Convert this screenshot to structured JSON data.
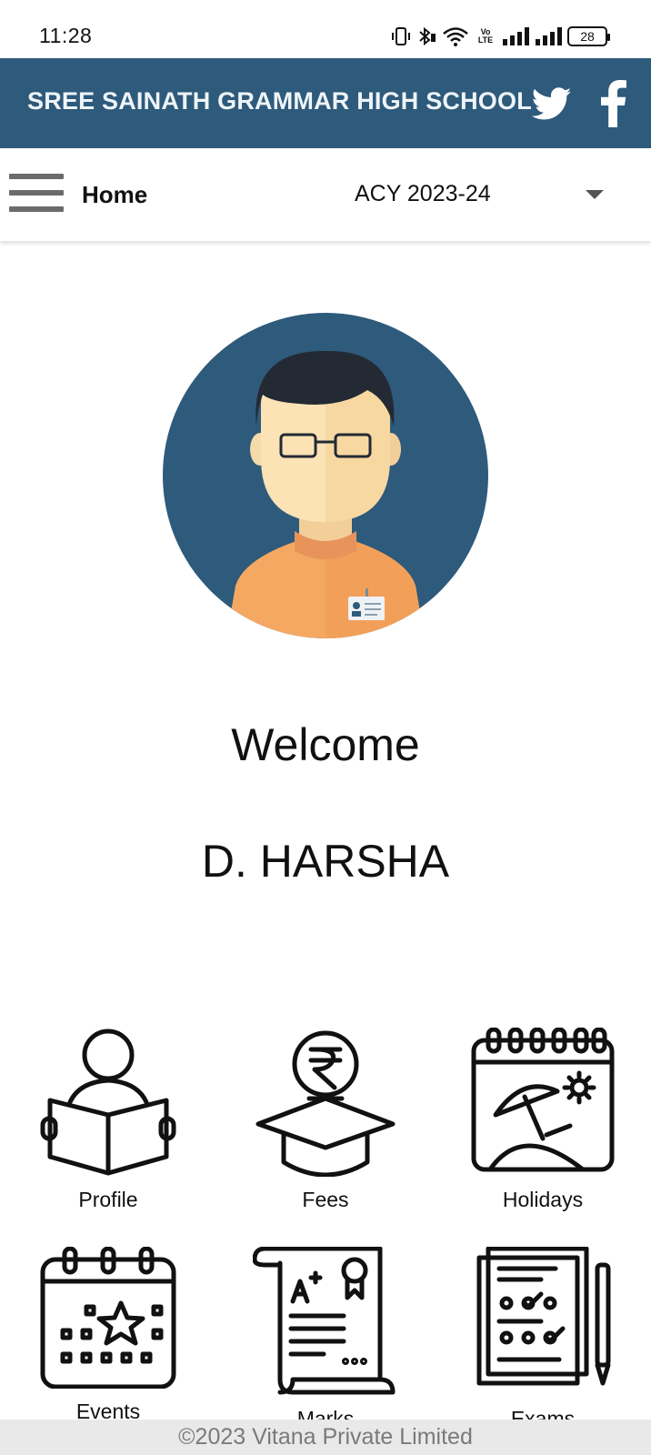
{
  "status_bar": {
    "time": "11:28",
    "volte_line1": "Vo",
    "volte_line2": "LTE",
    "battery": "28"
  },
  "header": {
    "school_name": "SREE SAINATH GRAMMAR HIGH SCHOOL",
    "background_color": "#2e5a7b",
    "twitter_icon": "twitter-icon",
    "facebook_icon": "facebook-icon"
  },
  "nav": {
    "title": "Home",
    "academic_year": "ACY 2023-24"
  },
  "main": {
    "welcome": "Welcome",
    "user_name": "D. HARSHA"
  },
  "menu": [
    {
      "label": "Profile",
      "icon": "reading-student-icon"
    },
    {
      "label": "Fees",
      "icon": "rupee-graduation-cap-icon"
    },
    {
      "label": "Holidays",
      "icon": "holiday-calendar-icon"
    },
    {
      "label": "Events",
      "icon": "events-calendar-icon"
    },
    {
      "label": "Marks",
      "icon": "marks-certificate-icon"
    },
    {
      "label": "Exams",
      "icon": "exam-paper-icon"
    }
  ],
  "footer": {
    "copyright": "©2023 Vitana Private Limited"
  }
}
